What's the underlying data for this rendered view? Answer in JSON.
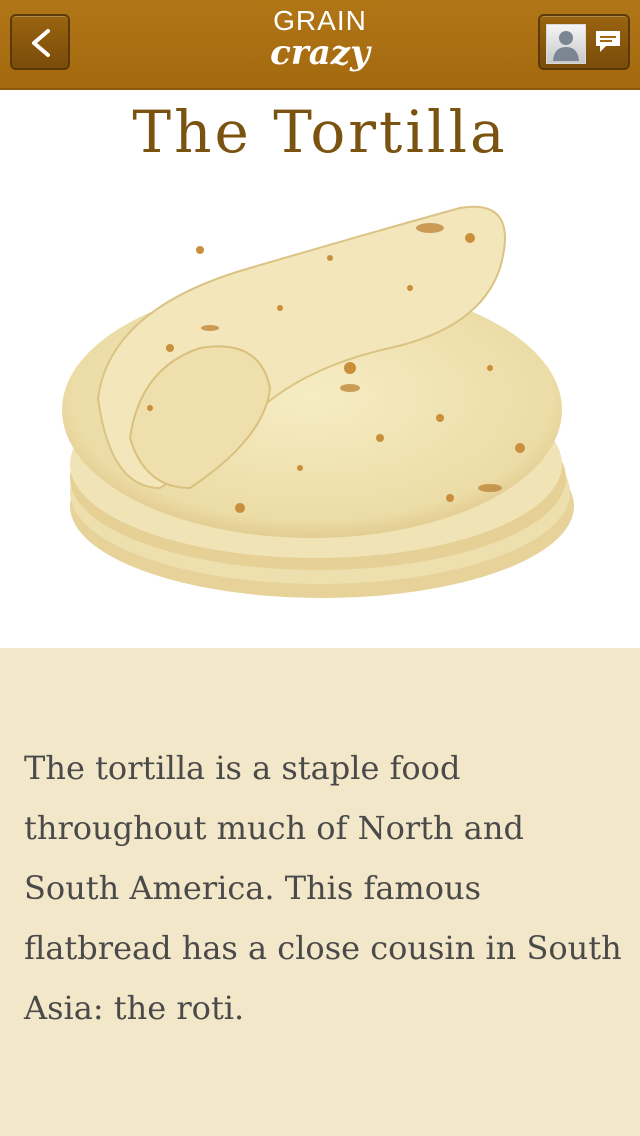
{
  "header": {
    "logo_top": "GRAIN",
    "logo_bottom": "crazy",
    "back_icon": "chevron-left-icon",
    "avatar_icon": "user-avatar-icon",
    "chat_icon": "speech-bubble-icon"
  },
  "article": {
    "title": "The Tortilla",
    "image": "tortilla-stack-photo",
    "body": "The tortilla is a staple food throughout much of North and South America. This famous flatbread has a close cousin in South Asia: the roti."
  },
  "colors": {
    "navbar": "#a96f12",
    "title": "#7b5311",
    "panel": "#f2e7c8",
    "text": "#4a4a4a"
  }
}
